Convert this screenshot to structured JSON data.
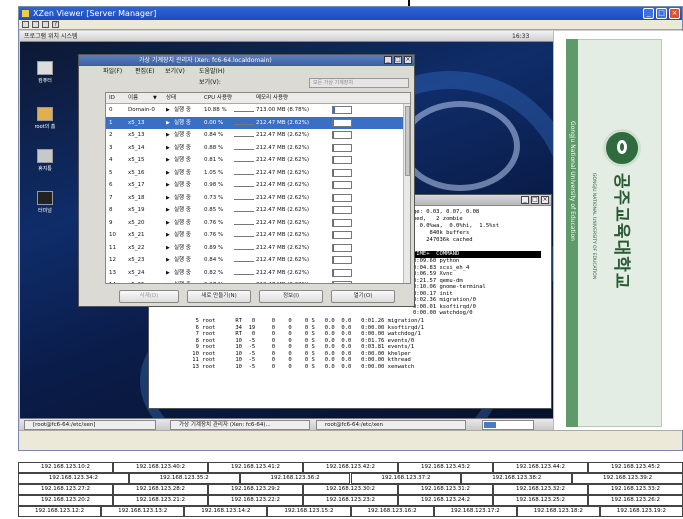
{
  "viewer": {
    "title": "XZen Viewer [Server Manager]"
  },
  "remote_panel": {
    "apps": "프로그램  위치  시스템",
    "clock": "16:33"
  },
  "desktop_icons": [
    {
      "label": "컴퓨터",
      "icon": "computer-icon"
    },
    {
      "label": "root의 홈",
      "icon": "home-folder-icon"
    },
    {
      "label": "휴지통",
      "icon": "trash-icon"
    },
    {
      "label": "터미널",
      "icon": "terminal-icon"
    }
  ],
  "vmm": {
    "title": "가상 기계장치 관리자 (Xen: fc6-64.localdomain)",
    "menu": [
      "파일(F)",
      "편집(E)",
      "보기(V)",
      "도움말(H)"
    ],
    "view_label": "보기(V):",
    "view_select": "모든 가상 기계장치",
    "columns": {
      "id": "ID",
      "name": "이름",
      "status": "상태",
      "cpu": "CPU 사용량",
      "mem": "메모리 사용량"
    },
    "rows": [
      {
        "id": "0",
        "name": "Domain-0",
        "status": "실행 중",
        "cpu": "10.88 %",
        "mem": "713.00 MB (8.78%)",
        "mem_fill": 0.09
      },
      {
        "id": "1",
        "name": "x5_13",
        "status": "실행 중",
        "cpu": "0.00 %",
        "mem": "212.47 MB (2.62%)",
        "mem_fill": 0.03
      },
      {
        "id": "2",
        "name": "x5_13",
        "status": "실행 중",
        "cpu": "0.84 %",
        "mem": "212.47 MB (2.62%)",
        "mem_fill": 0.03
      },
      {
        "id": "3",
        "name": "x5_14",
        "status": "실행 중",
        "cpu": "0.88 %",
        "mem": "212.47 MB (2.62%)",
        "mem_fill": 0.03
      },
      {
        "id": "4",
        "name": "x5_15",
        "status": "실행 중",
        "cpu": "0.81 %",
        "mem": "212.47 MB (2.62%)",
        "mem_fill": 0.03
      },
      {
        "id": "5",
        "name": "x5_16",
        "status": "실행 중",
        "cpu": "1.05 %",
        "mem": "212.47 MB (2.62%)",
        "mem_fill": 0.03
      },
      {
        "id": "6",
        "name": "x5_17",
        "status": "실행 중",
        "cpu": "0.98 %",
        "mem": "212.47 MB (2.62%)",
        "mem_fill": 0.03
      },
      {
        "id": "7",
        "name": "x5_18",
        "status": "실행 중",
        "cpu": "0.73 %",
        "mem": "212.47 MB (2.62%)",
        "mem_fill": 0.03
      },
      {
        "id": "8",
        "name": "x5_19",
        "status": "실행 중",
        "cpu": "0.85 %",
        "mem": "212.47 MB (2.62%)",
        "mem_fill": 0.03
      },
      {
        "id": "9",
        "name": "x5_20",
        "status": "실행 중",
        "cpu": "0.76 %",
        "mem": "212.47 MB (2.62%)",
        "mem_fill": 0.03
      },
      {
        "id": "10",
        "name": "x5_21",
        "status": "실행 중",
        "cpu": "0.76 %",
        "mem": "212.47 MB (2.62%)",
        "mem_fill": 0.03
      },
      {
        "id": "11",
        "name": "x5_22",
        "status": "실행 중",
        "cpu": "0.89 %",
        "mem": "212.47 MB (2.62%)",
        "mem_fill": 0.03
      },
      {
        "id": "12",
        "name": "x5_23",
        "status": "실행 중",
        "cpu": "0.84 %",
        "mem": "212.47 MB (2.62%)",
        "mem_fill": 0.03
      },
      {
        "id": "13",
        "name": "x5_24",
        "status": "실행 중",
        "cpu": "0.82 %",
        "mem": "212.47 MB (2.62%)",
        "mem_fill": 0.03
      },
      {
        "id": "14",
        "name": "x5_25",
        "status": "실행 중",
        "cpu": "0.97 %",
        "mem": "212.47 MB (2.62%)",
        "mem_fill": 0.03
      }
    ],
    "buttons": {
      "delete": "삭제(D)",
      "new": "새로 만들기(N)",
      "details": "정보(I)",
      "open": "열기(O)"
    }
  },
  "terminal": {
    "top_lines": [
      "ge: 0.03, 0.07, 0.08",
      "ped,   2 zombie",
      "  0.0%wa,  0.0%hi,  1.5%st",
      ",    840k buffers",
      ",   247036k cached"
    ],
    "header": "TIME+  COMMAND",
    "cmd_lines": [
      "0:09.60 python",
      "0:04.83 scsi_eh_4",
      "0:06.59 Xvnc",
      "0:21.57 qemu-dm",
      "0:10.06 gnome-terminal",
      "0:00.17 init",
      "0:02.36 migration/0",
      "0:00.01 ksoftirqd/0",
      "0:00.00 watchdog/0"
    ],
    "proc_lines": [
      "  5 root      RT   0     0    0    0 S   0.0  0.0   0:01.26 migration/1",
      "  6 root      34  19     0    0    0 S   0.0  0.0   0:00.00 ksoftirqd/1",
      "  7 root      RT   0     0    0    0 S   0.0  0.0   0:00.00 watchdog/1",
      "  8 root      10  -5     0    0    0 S   0.0  0.0   0:01.76 events/0",
      "  9 root      10  -5     0    0    0 S   0.0  0.0   0:03.81 events/1",
      " 10 root      10  -5     0    0    0 S   0.0  0.0   0:00.00 khelper",
      " 11 root      10  -5     0    0    0 S   0.0  0.0   0:00.00 kthread",
      " 13 root      10  -5     0    0    0 S   0.0  0.0   0:00.00 xenwatch"
    ]
  },
  "taskbar": {
    "items": [
      "[root@fc6-64:/etc/xen]",
      "가상 기계장치 관리자 (Xen: fc6-64)...",
      "root@fc6-64:/etc/xen"
    ]
  },
  "right_pane": {
    "university_en": "Gongju National University of Education",
    "university_ko": "공주교육대학교",
    "university_ko_sub": "GONGJU NATIONAL UNIVERSITY OF EDUCATION"
  },
  "ip_grid": [
    [
      "192.168.123.10:2",
      "192.168.123.40:2",
      "192.168.123.41:2",
      "192.168.123.42:2",
      "192.168.123.43:2",
      "192.168.123.44:2",
      "192.168.123.45:2"
    ],
    [
      "192.168.123.34:2",
      "192.168.123.35:2",
      "192.168.123.36:2",
      "192.168.123.37:2",
      "192.168.123.38:2",
      "192.168.123.39:2"
    ],
    [
      "192.168.123.27:2",
      "192.168.123.28:2",
      "192.168.123.29:2",
      "192.168.123.30:2",
      "192.168.123.31:2",
      "192.168.123.32:2",
      "192.168.123.33:2"
    ],
    [
      "192.168.123.20:2",
      "192.168.123.21:2",
      "192.168.123.22:2",
      "192.168.123.23:2",
      "192.168.123.24:2",
      "192.168.123.25:2",
      "192.168.123.26:2"
    ],
    [
      "192.168.123.12:2",
      "192.168.123.13:2",
      "192.168.123.14:2",
      "192.168.123.15:2",
      "192.168.123.16:2",
      "192.168.123.17:2",
      "192.168.123.18:2",
      "192.168.123.19:2"
    ]
  ]
}
